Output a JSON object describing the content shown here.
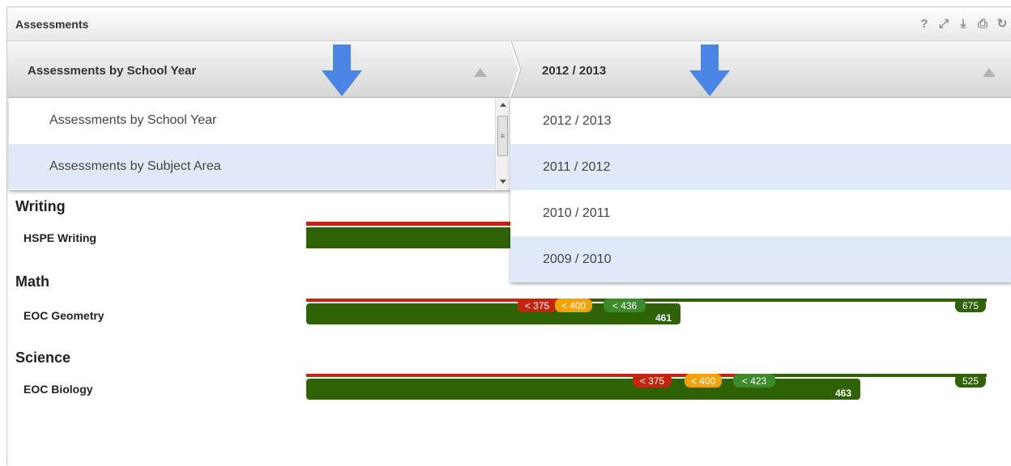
{
  "window": {
    "title": "Assessments",
    "tool_icons": [
      "help-icon",
      "expand-icon",
      "download-icon",
      "print-icon",
      "refresh-icon"
    ],
    "tool_glyphs": [
      "?",
      "⤢",
      "⤓",
      "⎙",
      "↻"
    ]
  },
  "selectors": {
    "left": {
      "label": "Assessments by School Year"
    },
    "right": {
      "label": "2012 / 2013"
    }
  },
  "left_dropdown": {
    "options": [
      "Assessments by School Year",
      "Assessments by Subject Area"
    ],
    "highlighted_index": 1
  },
  "right_dropdown": {
    "options": [
      "2012 / 2013",
      "2011 / 2012",
      "2010 / 2011",
      "2009 / 2010"
    ],
    "highlighted_indices": [
      1,
      3
    ]
  },
  "colors": {
    "red": "#c0260e",
    "orange": "#f0a30a",
    "green_light": "#3c8b2a",
    "green_dark": "#2f6205",
    "arrow_blue": "#4a85e5",
    "highlight": "#dfe9f7"
  },
  "subjects": [
    {
      "category": "Writing",
      "assessment": "HSPE Writing",
      "thresholds": [],
      "max_label": "",
      "score_label": ""
    },
    {
      "category": "Math",
      "assessment": "EOC Geometry",
      "thresholds": [
        "< 375",
        "< 400",
        "< 436"
      ],
      "max_label": "675",
      "score_label": "461"
    },
    {
      "category": "Science",
      "assessment": "EOC Biology",
      "thresholds": [
        "< 375",
        "< 400",
        "< 423"
      ],
      "max_label": "525",
      "score_label": "463"
    }
  ]
}
